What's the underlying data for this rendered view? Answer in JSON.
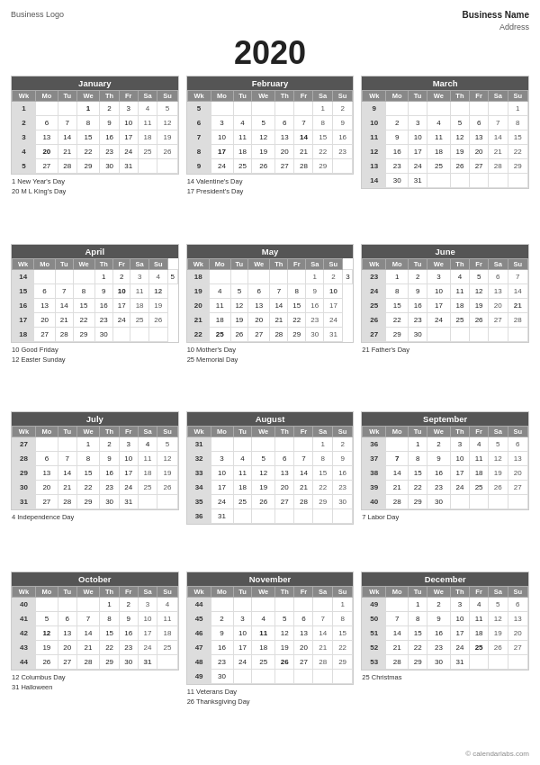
{
  "header": {
    "left": "Business Logo",
    "right_name": "Business Name",
    "right_address": "Address"
  },
  "year": "2020",
  "footer": "© calendarlabs.com",
  "months": [
    {
      "name": "January",
      "rows": [
        [
          "1",
          "",
          "",
          "1",
          "2",
          "3",
          "4",
          "5"
        ],
        [
          "2",
          "6",
          "7",
          "8",
          "9",
          "10",
          "11",
          "12"
        ],
        [
          "3",
          "13",
          "14",
          "15",
          "16",
          "17",
          "18",
          "19"
        ],
        [
          "4",
          "20",
          "21",
          "22",
          "23",
          "24",
          "25",
          "26"
        ],
        [
          "5",
          "27",
          "28",
          "29",
          "30",
          "31",
          "",
          ""
        ]
      ],
      "holidays": [
        "1  New Year's Day",
        "20  M L King's Day"
      ],
      "bold_cells": [
        "1",
        "20"
      ]
    },
    {
      "name": "February",
      "rows": [
        [
          "5",
          "",
          "",
          "",
          "",
          "",
          "1",
          "2"
        ],
        [
          "6",
          "3",
          "4",
          "5",
          "6",
          "7",
          "8",
          "9"
        ],
        [
          "7",
          "10",
          "11",
          "12",
          "13",
          "14",
          "15",
          "16"
        ],
        [
          "8",
          "17",
          "18",
          "19",
          "20",
          "21",
          "22",
          "23"
        ],
        [
          "9",
          "24",
          "25",
          "26",
          "27",
          "28",
          "29",
          ""
        ]
      ],
      "holidays": [
        "14  Valentine's Day",
        "17  President's Day"
      ],
      "bold_cells": [
        "14",
        "17"
      ]
    },
    {
      "name": "March",
      "rows": [
        [
          "9",
          "",
          "",
          "",
          "",
          "",
          "",
          "1"
        ],
        [
          "10",
          "2",
          "3",
          "4",
          "5",
          "6",
          "7",
          "8"
        ],
        [
          "11",
          "9",
          "10",
          "11",
          "12",
          "13",
          "14",
          "15"
        ],
        [
          "12",
          "16",
          "17",
          "18",
          "19",
          "20",
          "21",
          "22"
        ],
        [
          "13",
          "23",
          "24",
          "25",
          "26",
          "27",
          "28",
          "29"
        ],
        [
          "14",
          "30",
          "31",
          "",
          "",
          "",
          "",
          ""
        ]
      ],
      "holidays": [],
      "bold_cells": []
    },
    {
      "name": "April",
      "rows": [
        [
          "14",
          "",
          "",
          "",
          "1",
          "2",
          "3",
          "4",
          "5"
        ],
        [
          "15",
          "6",
          "7",
          "8",
          "9",
          "10",
          "11",
          "12"
        ],
        [
          "16",
          "13",
          "14",
          "15",
          "16",
          "17",
          "18",
          "19"
        ],
        [
          "17",
          "20",
          "21",
          "22",
          "23",
          "24",
          "25",
          "26"
        ],
        [
          "18",
          "27",
          "28",
          "29",
          "30",
          "",
          "",
          ""
        ]
      ],
      "holidays": [
        "10  Good Friday",
        "12  Easter Sunday"
      ],
      "bold_cells": [
        "10",
        "12"
      ]
    },
    {
      "name": "May",
      "rows": [
        [
          "18",
          "",
          "",
          "",
          "",
          "",
          "1",
          "2",
          "3"
        ],
        [
          "19",
          "4",
          "5",
          "6",
          "7",
          "8",
          "9",
          "10"
        ],
        [
          "20",
          "11",
          "12",
          "13",
          "14",
          "15",
          "16",
          "17"
        ],
        [
          "21",
          "18",
          "19",
          "20",
          "21",
          "22",
          "23",
          "24"
        ],
        [
          "22",
          "25",
          "26",
          "27",
          "28",
          "29",
          "30",
          "31"
        ]
      ],
      "holidays": [
        "10  Mother's Day",
        "25  Memorial Day"
      ],
      "bold_cells": [
        "10",
        "25"
      ]
    },
    {
      "name": "June",
      "rows": [
        [
          "23",
          "1",
          "2",
          "3",
          "4",
          "5",
          "6",
          "7"
        ],
        [
          "24",
          "8",
          "9",
          "10",
          "11",
          "12",
          "13",
          "14"
        ],
        [
          "25",
          "15",
          "16",
          "17",
          "18",
          "19",
          "20",
          "21"
        ],
        [
          "26",
          "22",
          "23",
          "24",
          "25",
          "26",
          "27",
          "28"
        ],
        [
          "27",
          "29",
          "30",
          "",
          "",
          "",
          "",
          ""
        ]
      ],
      "holidays": [
        "21  Father's Day"
      ],
      "bold_cells": [
        "21"
      ]
    },
    {
      "name": "July",
      "rows": [
        [
          "27",
          "",
          "",
          "1",
          "2",
          "3",
          "4",
          "5"
        ],
        [
          "28",
          "6",
          "7",
          "8",
          "9",
          "10",
          "11",
          "12"
        ],
        [
          "29",
          "13",
          "14",
          "15",
          "16",
          "17",
          "18",
          "19"
        ],
        [
          "30",
          "20",
          "21",
          "22",
          "23",
          "24",
          "25",
          "26"
        ],
        [
          "31",
          "27",
          "28",
          "29",
          "30",
          "31",
          "",
          ""
        ]
      ],
      "holidays": [
        "4  Independence Day"
      ],
      "bold_cells": [
        "4"
      ]
    },
    {
      "name": "August",
      "rows": [
        [
          "31",
          "",
          "",
          "",
          "",
          "",
          "1",
          "2"
        ],
        [
          "32",
          "3",
          "4",
          "5",
          "6",
          "7",
          "8",
          "9"
        ],
        [
          "33",
          "10",
          "11",
          "12",
          "13",
          "14",
          "15",
          "16"
        ],
        [
          "34",
          "17",
          "18",
          "19",
          "20",
          "21",
          "22",
          "23"
        ],
        [
          "35",
          "24",
          "25",
          "26",
          "27",
          "28",
          "29",
          "30"
        ],
        [
          "36",
          "31",
          "",
          "",
          "",
          "",
          "",
          ""
        ]
      ],
      "holidays": [],
      "bold_cells": []
    },
    {
      "name": "September",
      "rows": [
        [
          "36",
          "",
          "1",
          "2",
          "3",
          "4",
          "5",
          "6"
        ],
        [
          "37",
          "7",
          "8",
          "9",
          "10",
          "11",
          "12",
          "13"
        ],
        [
          "38",
          "14",
          "15",
          "16",
          "17",
          "18",
          "19",
          "20"
        ],
        [
          "39",
          "21",
          "22",
          "23",
          "24",
          "25",
          "26",
          "27"
        ],
        [
          "40",
          "28",
          "29",
          "30",
          "",
          "",
          "",
          ""
        ]
      ],
      "holidays": [
        "7  Labor Day"
      ],
      "bold_cells": [
        "7"
      ]
    },
    {
      "name": "October",
      "rows": [
        [
          "40",
          "",
          "",
          "",
          "1",
          "2",
          "3",
          "4"
        ],
        [
          "41",
          "5",
          "6",
          "7",
          "8",
          "9",
          "10",
          "11"
        ],
        [
          "42",
          "12",
          "13",
          "14",
          "15",
          "16",
          "17",
          "18"
        ],
        [
          "43",
          "19",
          "20",
          "21",
          "22",
          "23",
          "24",
          "25"
        ],
        [
          "44",
          "26",
          "27",
          "28",
          "29",
          "30",
          "31",
          ""
        ]
      ],
      "holidays": [
        "12  Columbus Day",
        "31  Halloween"
      ],
      "bold_cells": [
        "12",
        "31"
      ]
    },
    {
      "name": "November",
      "rows": [
        [
          "44",
          "",
          "",
          "",
          "",
          "",
          "",
          "1"
        ],
        [
          "45",
          "2",
          "3",
          "4",
          "5",
          "6",
          "7",
          "8"
        ],
        [
          "46",
          "9",
          "10",
          "11",
          "12",
          "13",
          "14",
          "15"
        ],
        [
          "47",
          "16",
          "17",
          "18",
          "19",
          "20",
          "21",
          "22"
        ],
        [
          "48",
          "23",
          "24",
          "25",
          "26",
          "27",
          "28",
          "29"
        ],
        [
          "49",
          "30",
          "",
          "",
          "",
          "",
          "",
          ""
        ]
      ],
      "holidays": [
        "11  Veterans Day",
        "26  Thanksgiving Day"
      ],
      "bold_cells": [
        "11",
        "26"
      ]
    },
    {
      "name": "December",
      "rows": [
        [
          "49",
          "",
          "1",
          "2",
          "3",
          "4",
          "5",
          "6"
        ],
        [
          "50",
          "7",
          "8",
          "9",
          "10",
          "11",
          "12",
          "13"
        ],
        [
          "51",
          "14",
          "15",
          "16",
          "17",
          "18",
          "19",
          "20"
        ],
        [
          "52",
          "21",
          "22",
          "23",
          "24",
          "25",
          "26",
          "27"
        ],
        [
          "53",
          "28",
          "29",
          "30",
          "31",
          "",
          "",
          ""
        ]
      ],
      "holidays": [
        "25  Christmas"
      ],
      "bold_cells": [
        "25"
      ]
    }
  ],
  "col_headers": [
    "Wk",
    "Mo",
    "Tu",
    "We",
    "Th",
    "Fr",
    "Sa",
    "Su"
  ]
}
